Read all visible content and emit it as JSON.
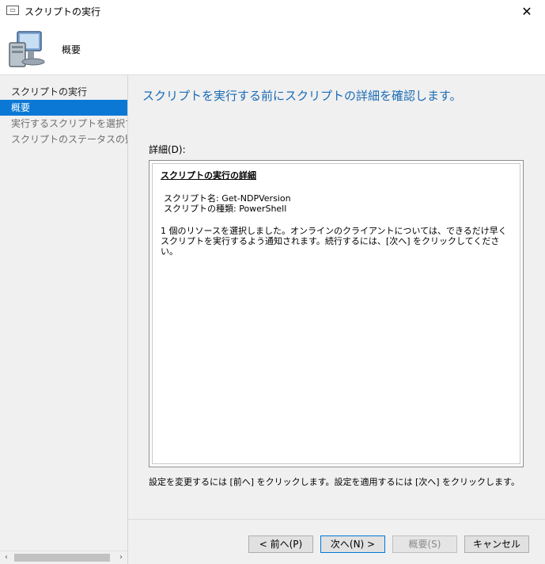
{
  "window": {
    "title": "スクリプトの実行",
    "close_symbol": "✕"
  },
  "header": {
    "title": "概要"
  },
  "sidebar": {
    "items": [
      {
        "label": "スクリプトの実行",
        "state": "normal"
      },
      {
        "label": "概要",
        "state": "active"
      },
      {
        "label": "実行するスクリプトを選択する",
        "state": "disabled"
      },
      {
        "label": "スクリプトのステータスの監視",
        "state": "disabled"
      }
    ],
    "scroll_left": "‹",
    "scroll_right": "›"
  },
  "main": {
    "heading": "スクリプトを実行する前にスクリプトの詳細を確認します。",
    "details_label": "詳細(D):",
    "details": {
      "section_title": "スクリプトの実行の詳細",
      "script_name": "スクリプト名: Get-NDPVersion",
      "script_type": "スクリプトの種類: PowerShell",
      "message": "1 個のリソースを選択しました。オンラインのクライアントについては、できるだけ早くスクリプトを実行するよう通知されます。続行するには、[次へ] をクリックしてください。"
    },
    "hint": "設定を変更するには [前へ] をクリックします。設定を適用するには [次へ] をクリックします。"
  },
  "buttons": {
    "prev": "< 前へ(P)",
    "next": "次へ(N) >",
    "summary": "概要(S)",
    "cancel": "キャンセル"
  },
  "colors": {
    "accent": "#0a78d4",
    "heading": "#1a6bb5"
  }
}
